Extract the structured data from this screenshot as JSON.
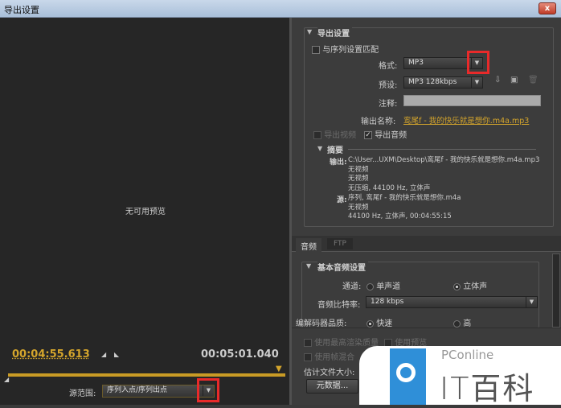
{
  "window": {
    "title": "导出设置",
    "close": "x"
  },
  "preview": {
    "no_preview": "无可用预览",
    "current_time": "00:04:55.613",
    "duration": "00:05:01.040",
    "source_range_label": "源范围:",
    "source_range_value": "序列入点/序列出点"
  },
  "export_settings": {
    "section_title": "导出设置",
    "match_sequence": "与序列设置匹配",
    "format_label": "格式:",
    "format_value": "MP3",
    "preset_label": "预设:",
    "preset_value": "MP3 128kbps",
    "comment_label": "注释:",
    "comment_value": "",
    "output_name_label": "输出名称:",
    "output_name_value": "鸾尾f - 我的快乐就是想你.m4a.mp3",
    "export_video": "导出视频",
    "export_audio": "导出音频"
  },
  "summary": {
    "title": "摘要",
    "output_label": "输出:",
    "output_lines": [
      "C:\\User...UXM\\Desktop\\鸾尾f - 我的快乐就是想你.m4a.mp3",
      "无视频",
      "无视频",
      "无压缩, 44100 Hz, 立体声"
    ],
    "source_label": "源:",
    "source_lines": [
      "序列, 鸾尾f - 我的快乐就是想你.m4a",
      "无视频",
      "44100 Hz, 立体声, 00:04:55:15"
    ]
  },
  "tabs": [
    {
      "label": "音频",
      "active": true
    },
    {
      "label": "FTP",
      "active": false
    }
  ],
  "audio": {
    "section_title": "基本音频设置",
    "channel_label": "通道:",
    "mono": "单声道",
    "stereo": "立体声",
    "bitrate_label": "音频比特率:",
    "bitrate_value": "128 kbps",
    "codec_quality_label": "编解码器品质:",
    "fast": "快速",
    "high": "高"
  },
  "options": {
    "max_render": "使用最高渲染质量",
    "use_preview": "使用预览",
    "use_frame_blend": "使用帧混合",
    "est_size_label": "估计文件大小:",
    "metadata_button": "元数据..."
  },
  "watermark": {
    "brand": "PConline",
    "name": "IT百科"
  }
}
